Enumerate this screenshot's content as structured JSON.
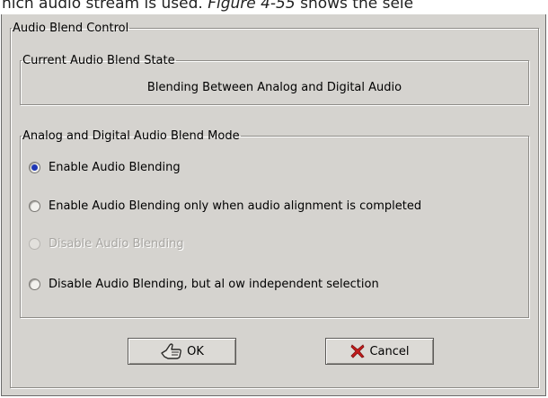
{
  "document": {
    "text_prefix": "hich audio stream is used. ",
    "text_figure": "Figure 4-55",
    "text_suffix": " shows the sele"
  },
  "dialog": {
    "group_title": "Audio Blend Control",
    "state": {
      "title": "Current Audio Blend State",
      "value": "Blending Between Analog and Digital Audio"
    },
    "mode": {
      "title": "Analog and Digital Audio Blend Mode",
      "options": [
        {
          "label": "Enable Audio Blending",
          "checked": true,
          "disabled": false
        },
        {
          "label": "Enable Audio Blending only when audio alignment is completed",
          "checked": false,
          "disabled": false
        },
        {
          "label": "Disable Audio Blending",
          "checked": false,
          "disabled": true
        },
        {
          "label": "Disable Audio Blending, but al ow independent selection",
          "checked": false,
          "disabled": false
        }
      ]
    },
    "buttons": {
      "ok_label": "OK",
      "cancel_label": "Cancel"
    },
    "icons": {
      "ok": "thumbs-up-icon",
      "cancel": "red-x-icon"
    },
    "colors": {
      "radio_selected": "#1f37b5",
      "cancel_icon": "#c61c1c",
      "dialog_bg": "#d5d3cf"
    }
  }
}
